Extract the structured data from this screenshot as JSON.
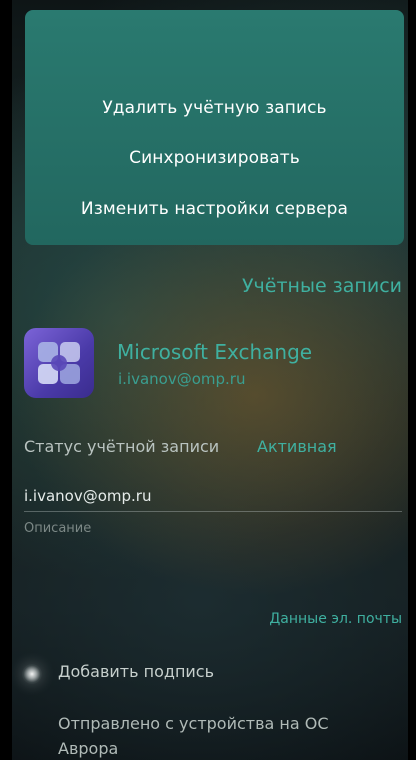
{
  "pulley_menu": {
    "items": [
      {
        "label": "Удалить учётную запись"
      },
      {
        "label": "Синхронизировать"
      },
      {
        "label": "Изменить настройки сервера"
      }
    ]
  },
  "page": {
    "section_header": "Учётные записи"
  },
  "account": {
    "icon": "microsoft-exchange-icon",
    "name": "Microsoft Exchange",
    "email": "i.ivanov@omp.ru"
  },
  "status": {
    "label": "Статус учётной записи",
    "value": "Активная"
  },
  "description_field": {
    "value": "i.ivanov@omp.ru",
    "label": "Описание"
  },
  "email_section": {
    "header": "Данные эл. почты",
    "add_signature_label": "Добавить подпись",
    "signature_line1": "Отправлено с устройства на ОС",
    "signature_line2": "Аврора"
  },
  "colors": {
    "accent": "#3fb0a0",
    "menu_background": "#26706a"
  }
}
